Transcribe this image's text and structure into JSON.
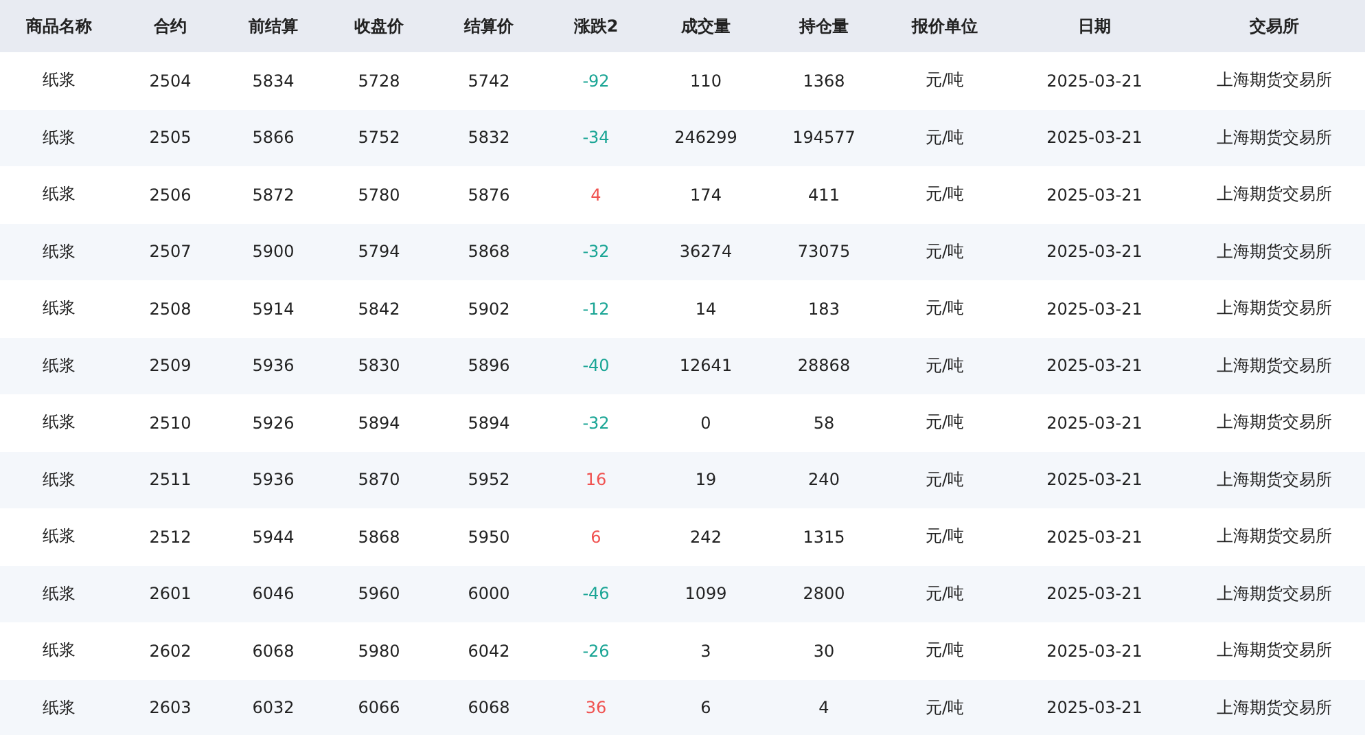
{
  "table": {
    "columns": [
      "商品名称",
      "合约",
      "前结算",
      "收盘价",
      "结算价",
      "涨跌2",
      "成交量",
      "持仓量",
      "报价单位",
      "日期",
      "交易所"
    ],
    "rows": [
      {
        "cells": [
          "纸浆",
          "2504",
          "5834",
          "5728",
          "5742",
          "-92",
          "110",
          "1368",
          "元/吨",
          "2025-03-21",
          "上海期货交易所"
        ],
        "color": "#1aa595"
      },
      {
        "cells": [
          "纸浆",
          "2505",
          "5866",
          "5752",
          "5832",
          "-34",
          "246299",
          "194577",
          "元/吨",
          "2025-03-21",
          "上海期货交易所"
        ],
        "color": "#1aa595"
      },
      {
        "cells": [
          "纸浆",
          "2506",
          "5872",
          "5780",
          "5876",
          "4",
          "174",
          "411",
          "元/吨",
          "2025-03-21",
          "上海期货交易所"
        ],
        "color": "#f0514f"
      },
      {
        "cells": [
          "纸浆",
          "2507",
          "5900",
          "5794",
          "5868",
          "-32",
          "36274",
          "73075",
          "元/吨",
          "2025-03-21",
          "上海期货交易所"
        ],
        "color": "#1aa595"
      },
      {
        "cells": [
          "纸浆",
          "2508",
          "5914",
          "5842",
          "5902",
          "-12",
          "14",
          "183",
          "元/吨",
          "2025-03-21",
          "上海期货交易所"
        ],
        "color": "#1aa595"
      },
      {
        "cells": [
          "纸浆",
          "2509",
          "5936",
          "5830",
          "5896",
          "-40",
          "12641",
          "28868",
          "元/吨",
          "2025-03-21",
          "上海期货交易所"
        ],
        "color": "#1aa595"
      },
      {
        "cells": [
          "纸浆",
          "2510",
          "5926",
          "5894",
          "5894",
          "-32",
          "0",
          "58",
          "元/吨",
          "2025-03-21",
          "上海期货交易所"
        ],
        "color": "#1aa595"
      },
      {
        "cells": [
          "纸浆",
          "2511",
          "5936",
          "5870",
          "5952",
          "16",
          "19",
          "240",
          "元/吨",
          "2025-03-21",
          "上海期货交易所"
        ],
        "color": "#f0514f"
      },
      {
        "cells": [
          "纸浆",
          "2512",
          "5944",
          "5868",
          "5950",
          "6",
          "242",
          "1315",
          "元/吨",
          "2025-03-21",
          "上海期货交易所"
        ],
        "color": "#f0514f"
      },
      {
        "cells": [
          "纸浆",
          "2601",
          "6046",
          "5960",
          "6000",
          "-46",
          "1099",
          "2800",
          "元/吨",
          "2025-03-21",
          "上海期货交易所"
        ],
        "color": "#1aa595"
      },
      {
        "cells": [
          "纸浆",
          "2602",
          "6068",
          "5980",
          "6042",
          "-26",
          "3",
          "30",
          "元/吨",
          "2025-03-21",
          "上海期货交易所"
        ],
        "color": "#1aa595"
      },
      {
        "cells": [
          "纸浆",
          "2603",
          "6032",
          "6066",
          "6068",
          "36",
          "6",
          "4",
          "元/吨",
          "2025-03-21",
          "上海期货交易所"
        ],
        "color": "#f0514f"
      }
    ]
  }
}
